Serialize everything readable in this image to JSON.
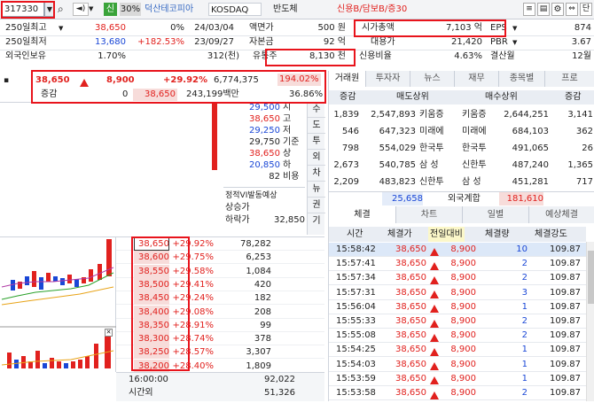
{
  "toolbar": {
    "code": "317330",
    "signal": "신",
    "margin": "30%",
    "name": "덕산테코피아",
    "market": "KOSDAQ",
    "sector": "반도체",
    "credit": "신용B/담보B/증30",
    "icons": [
      "search-icon",
      "speaker-icon",
      "unknown-arrow"
    ]
  },
  "info": {
    "row1": {
      "l": "250일최고",
      "v": "38,650",
      "pct": "0%",
      "date": "24/03/04",
      "k": "액면가",
      "kv": "500 원",
      "k2": "시가총액",
      "v2": "7,103 억",
      "k3": "EPS",
      "v3": "874"
    },
    "row2": {
      "l": "250일최저",
      "v": "13,680",
      "pct": "+182.53%",
      "date": "23/09/27",
      "k": "자본금",
      "kv": "92 억",
      "k2": "대용가",
      "v2": "21,420",
      "k3": "PBR",
      "v3": "3.67"
    },
    "row3": {
      "l": "외국인보유",
      "v": "1.70%",
      "date": "312(천)",
      "k": "유통주",
      "kv": "8,130 천",
      "k2": "신용비율",
      "v2": "4.63%",
      "k3": "결산월",
      "v3": "12월"
    }
  },
  "price": {
    "current": "38,650",
    "change": "8,900",
    "pct": "+29.92%",
    "volume": "6,774,375",
    "vol_pct": "194.02%",
    "label": "증감",
    "zero": "0",
    "p2": "38,650",
    "amount": "243,199백만",
    "rate": "36.86%"
  },
  "summary": [
    {
      "v": "29,500",
      "k": "시"
    },
    {
      "v": "38,650",
      "k": "고"
    },
    {
      "v": "29,250",
      "k": "저"
    },
    {
      "v": "29,750",
      "k": "기준"
    },
    {
      "v": "38,650",
      "k": "상"
    },
    {
      "v": "20,850",
      "k": "하"
    },
    {
      "v": "82",
      "k": "비용"
    }
  ],
  "vi": {
    "title": "정적VI발동예상",
    "up": "상승가",
    "down": "하락가",
    "down_val": "32,850"
  },
  "side_tabs": [
    "수",
    "도",
    "투",
    "외",
    "차",
    "뉴",
    "권",
    "기"
  ],
  "quotes": [
    {
      "p": "38,650",
      "pct": "+29.92%",
      "q": "78,282"
    },
    {
      "p": "38,600",
      "pct": "+29.75%",
      "q": "6,253"
    },
    {
      "p": "38,550",
      "pct": "+29.58%",
      "q": "1,084"
    },
    {
      "p": "38,500",
      "pct": "+29.41%",
      "q": "420"
    },
    {
      "p": "38,450",
      "pct": "+29.24%",
      "q": "182"
    },
    {
      "p": "38,400",
      "pct": "+29.08%",
      "q": "208"
    },
    {
      "p": "38,350",
      "pct": "+28.91%",
      "q": "99"
    },
    {
      "p": "38,300",
      "pct": "+28.74%",
      "q": "378"
    },
    {
      "p": "38,250",
      "pct": "+28.57%",
      "q": "3,307"
    },
    {
      "p": "38,200",
      "pct": "+28.40%",
      "q": "1,809"
    }
  ],
  "bottom": {
    "time": "16:00:00",
    "time_q": "92,022",
    "after": "시간외",
    "after_q": "51,326"
  },
  "broker_tabs": [
    "거래원",
    "투자자",
    "뉴스",
    "재무",
    "종목별",
    "프로"
  ],
  "broker_head": {
    "c1": "증감",
    "c2": "매도상위",
    "c3": "매수상위",
    "c4": "증감"
  },
  "brokers": [
    {
      "a": "1,839",
      "b": "2,547,893",
      "n1": "키움증",
      "n2": "키움증",
      "c": "2,644,251",
      "d": "3,141"
    },
    {
      "a": "546",
      "b": "647,323",
      "n1": "미래에",
      "n2": "미래에",
      "c": "684,103",
      "d": "362"
    },
    {
      "a": "798",
      "b": "554,029",
      "n1": "한국투",
      "n2": "한국투",
      "c": "491,065",
      "d": "26"
    },
    {
      "a": "2,673",
      "b": "540,785",
      "n1": "삼 성",
      "n2": "신한투",
      "c": "487,240",
      "d": "1,365"
    },
    {
      "a": "2,209",
      "b": "483,823",
      "n1": "신한투",
      "n2": "삼 성",
      "c": "451,281",
      "d": "717"
    }
  ],
  "foreign": {
    "s": "25,658",
    "label": "외국계합",
    "b": "181,610"
  },
  "trade_tabs": [
    "체결",
    "차트",
    "일별",
    "예상체결"
  ],
  "trade_head": {
    "t": "시간",
    "p": "체결가",
    "c": "전일대비",
    "q": "체결량",
    "s": "체결강도"
  },
  "trades": [
    {
      "t": "15:58:42",
      "p": "38,650",
      "c": "8,900",
      "q": "10",
      "s": "109.87"
    },
    {
      "t": "15:57:41",
      "p": "38,650",
      "c": "8,900",
      "q": "2",
      "s": "109.87"
    },
    {
      "t": "15:57:34",
      "p": "38,650",
      "c": "8,900",
      "q": "2",
      "s": "109.87"
    },
    {
      "t": "15:57:31",
      "p": "38,650",
      "c": "8,900",
      "q": "3",
      "s": "109.87"
    },
    {
      "t": "15:56:04",
      "p": "38,650",
      "c": "8,900",
      "q": "1",
      "s": "109.87"
    },
    {
      "t": "15:55:33",
      "p": "38,650",
      "c": "8,900",
      "q": "2",
      "s": "109.87"
    },
    {
      "t": "15:55:08",
      "p": "38,650",
      "c": "8,900",
      "q": "2",
      "s": "109.87"
    },
    {
      "t": "15:54:25",
      "p": "38,650",
      "c": "8,900",
      "q": "1",
      "s": "109.87"
    },
    {
      "t": "15:54:03",
      "p": "38,650",
      "c": "8,900",
      "q": "1",
      "s": "109.87"
    },
    {
      "t": "15:53:59",
      "p": "38,650",
      "c": "8,900",
      "q": "1",
      "s": "109.87"
    },
    {
      "t": "15:53:58",
      "p": "38,650",
      "c": "8,900",
      "q": "2",
      "s": "109.87"
    }
  ],
  "colors": {
    "up": "#e1211e",
    "down": "#1a47d6",
    "highlight": "#e8141c",
    "header_bg": "#e9edf3",
    "ask_bg": "#f7dcda",
    "row_sel": "#dce8f8"
  }
}
